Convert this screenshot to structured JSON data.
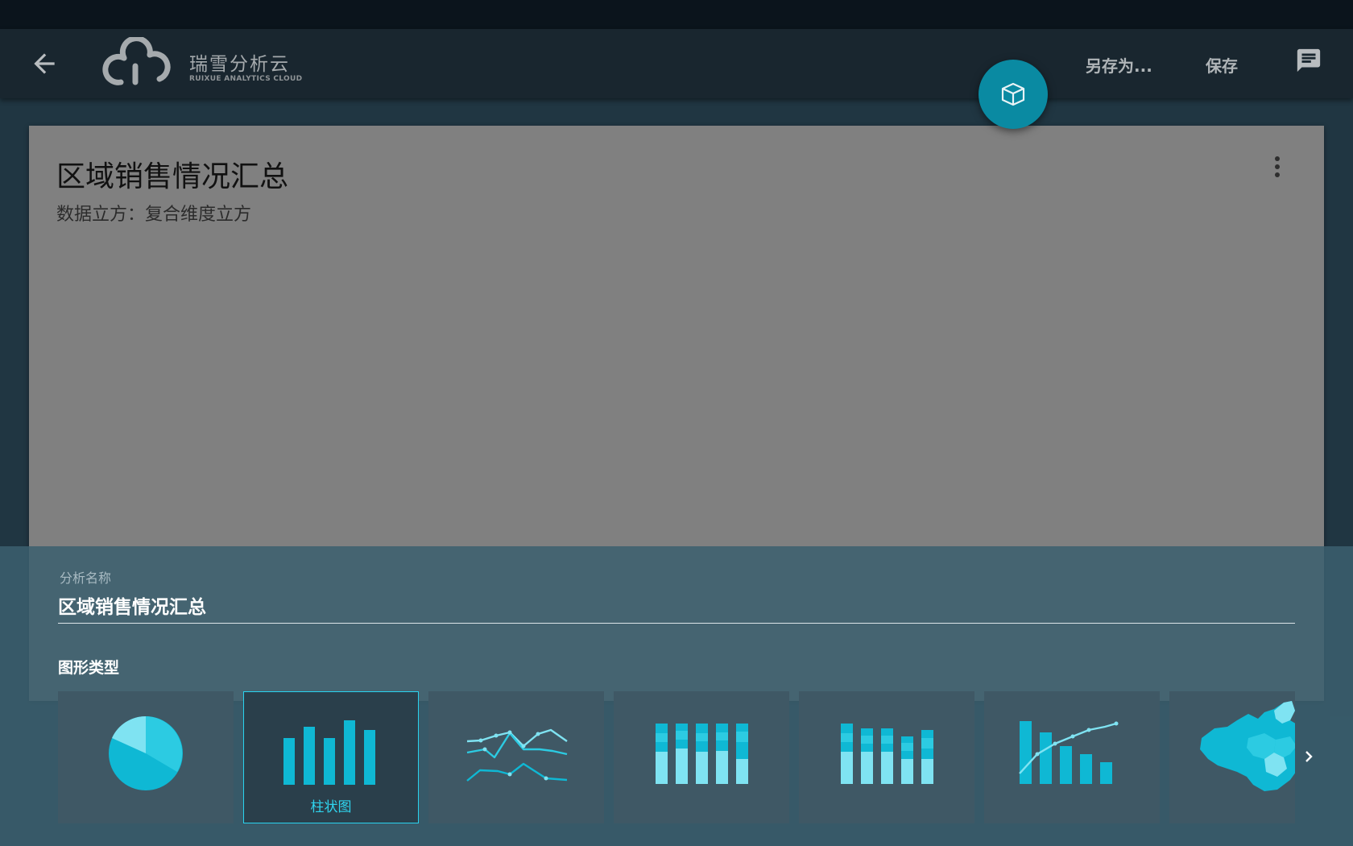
{
  "app": {
    "logo_text": "瑞雪分析云",
    "logo_subtext": "RUIXUE ANALYTICS CLOUD"
  },
  "toolbar": {
    "save_as_label": "另存为...",
    "save_label": "保存"
  },
  "icons": {
    "back": "arrow-left-icon",
    "cube": "cube-icon",
    "chat": "chat-icon",
    "more": "more-vert-icon",
    "next": "chevron-right-icon"
  },
  "card": {
    "title": "区域销售情况汇总",
    "subtitle": "数据立方：复合维度立方"
  },
  "sheet": {
    "name_label": "分析名称",
    "name_value": "区域销售情况汇总",
    "chart_type_label": "图形类型",
    "chart_types": [
      {
        "id": "pie",
        "label": "",
        "selected": false
      },
      {
        "id": "bar",
        "label": "柱状图",
        "selected": true
      },
      {
        "id": "line",
        "label": "",
        "selected": false
      },
      {
        "id": "stacked-bar-full",
        "label": "",
        "selected": false
      },
      {
        "id": "stacked-bar",
        "label": "",
        "selected": false
      },
      {
        "id": "bar-line",
        "label": "",
        "selected": false
      },
      {
        "id": "map",
        "label": "",
        "selected": false
      }
    ]
  },
  "colors": {
    "accent": "#0a8aa2",
    "chart_primary": "#0fb8d4",
    "chart_light": "#7fe3f2",
    "selected_border": "#29d3ef"
  }
}
